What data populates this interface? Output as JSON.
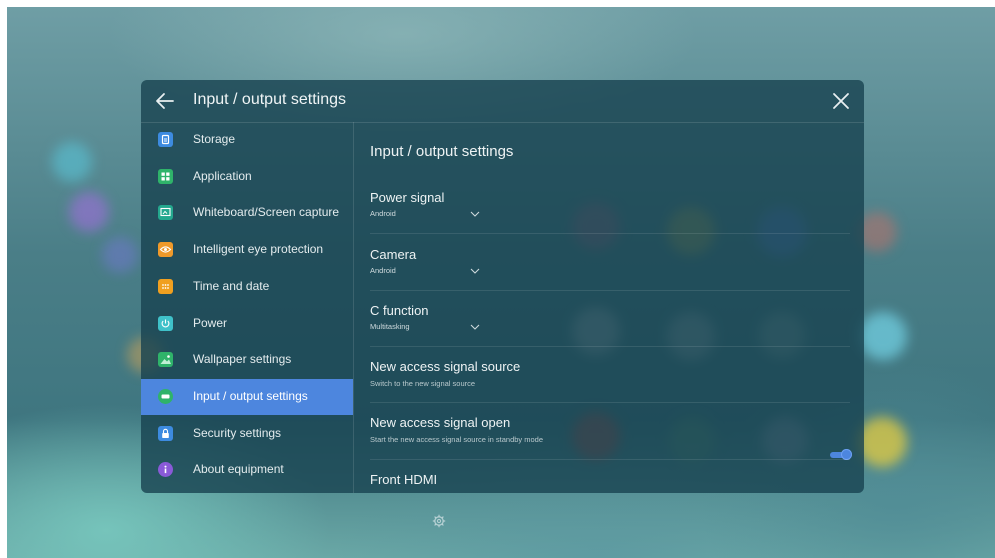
{
  "colors": {
    "accent": "#4d86de",
    "toggle_on": "#4d86de",
    "toggle_off_track": "#3b4f56",
    "toggle_off_knob": "#ffffff"
  },
  "header": {
    "back_icon": "arrow-left-icon",
    "title": "Input / output settings",
    "close_icon": "close-icon"
  },
  "sidebar": {
    "items": [
      {
        "label": "Storage",
        "icon": "storage-icon",
        "color": "#3d8be0",
        "active": false
      },
      {
        "label": "Application",
        "icon": "application-icon",
        "color": "#2fb36a",
        "active": false
      },
      {
        "label": "Whiteboard/Screen capture",
        "icon": "whiteboard-icon",
        "color": "#24a88e",
        "active": false
      },
      {
        "label": "Intelligent eye protection",
        "icon": "eye-protection-icon",
        "color": "#f09a2a",
        "active": false
      },
      {
        "label": "Time and date",
        "icon": "calendar-icon",
        "color": "#f0a020",
        "active": false
      },
      {
        "label": "Power",
        "icon": "power-icon",
        "color": "#3fc1c9",
        "active": false
      },
      {
        "label": "Wallpaper settings",
        "icon": "wallpaper-icon",
        "color": "#2fb36a",
        "active": false
      },
      {
        "label": "Input / output settings",
        "icon": "input-output-icon",
        "color": "#2fb36a",
        "active": true
      },
      {
        "label": "Security settings",
        "icon": "lock-icon",
        "color": "#3d8be0",
        "active": false
      },
      {
        "label": "About equipment",
        "icon": "info-icon",
        "color": "#8a5ad8",
        "active": false
      }
    ]
  },
  "content": {
    "title": "Input / output settings",
    "power_signal": {
      "label": "Power signal",
      "value": "Android"
    },
    "camera": {
      "label": "Camera",
      "value": "Android"
    },
    "c_function": {
      "label": "C function",
      "value": "Multitasking"
    },
    "new_access_source": {
      "label": "New access signal source",
      "description": "Switch to the new signal source",
      "enabled": true
    },
    "new_access_open": {
      "label": "New access signal open",
      "description": "Start the new access signal source in standby mode",
      "enabled": false
    },
    "front_hdmi": {
      "label": "Front HDMI"
    }
  },
  "dock": {
    "gear_icon": "settings-gear-icon"
  }
}
